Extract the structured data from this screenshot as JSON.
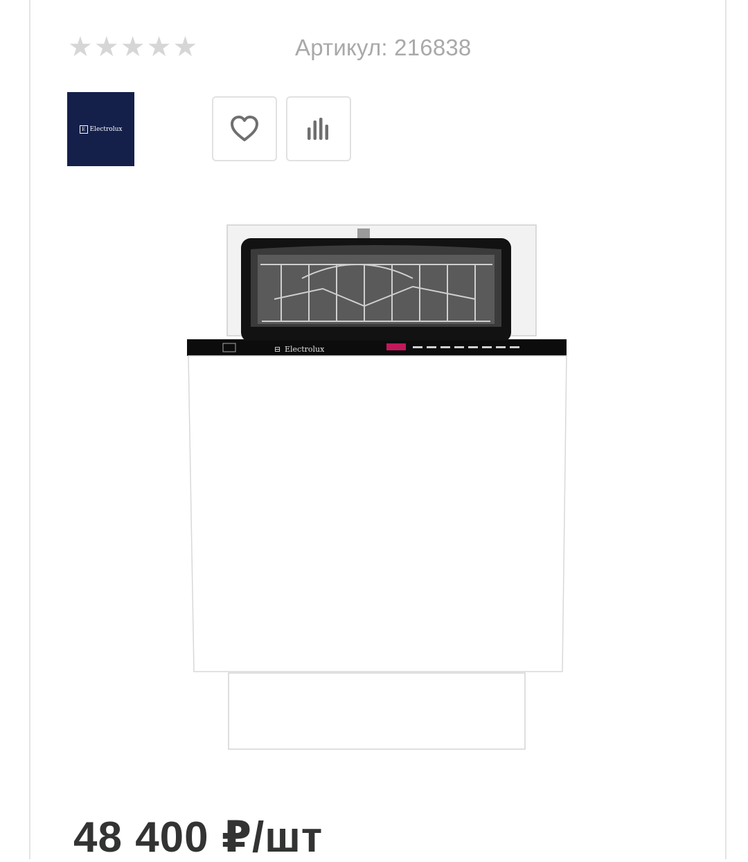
{
  "rating": {
    "stars_total": 5,
    "stars_filled": 0,
    "star_glyph": "★",
    "empty_color": "#d6d6d6"
  },
  "sku": {
    "text": "Артикул: 216838"
  },
  "brand": {
    "logo_text": "Electrolux",
    "logo_bg": "#14204a"
  },
  "actions": {
    "favorite_icon": "heart-icon",
    "compare_icon": "bar-chart-icon"
  },
  "product_image": {
    "panel_brand_text": "Electrolux"
  },
  "price": {
    "text": "48 400 ₽/шт"
  }
}
